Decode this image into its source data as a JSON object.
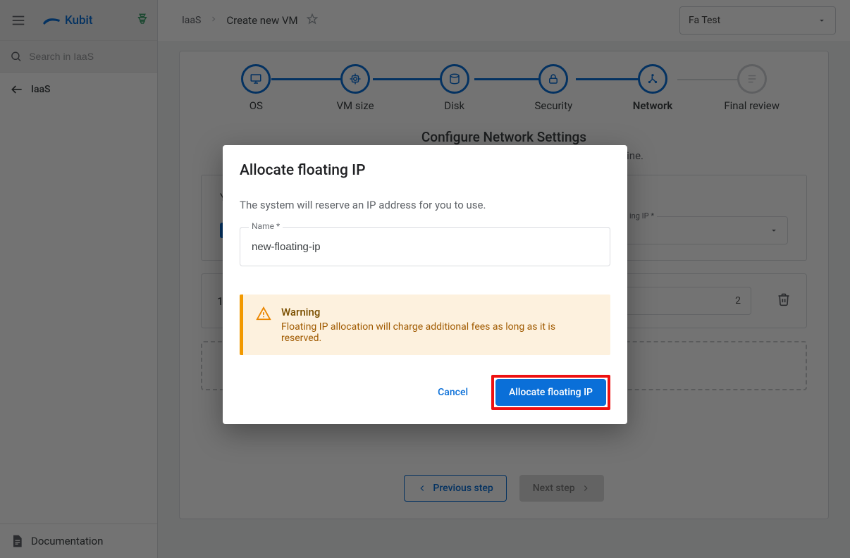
{
  "sidebar": {
    "brand": "Kubit",
    "search_placeholder": "Search in IaaS",
    "back_label": "IaaS",
    "doc_label": "Documentation"
  },
  "header": {
    "crumbs": [
      "IaaS",
      "Create new VM"
    ],
    "project_label": "Fa Test"
  },
  "stepper": {
    "steps": [
      {
        "label": "OS",
        "state": "done"
      },
      {
        "label": "VM size",
        "state": "done"
      },
      {
        "label": "Disk",
        "state": "done"
      },
      {
        "label": "Security",
        "state": "done"
      },
      {
        "label": "Network",
        "state": "active"
      },
      {
        "label": "Final review",
        "state": "inactive"
      }
    ]
  },
  "network": {
    "title": "Configure Network Settings",
    "subtitle_suffix": "ine.",
    "panel1_title_prefix": "You",
    "floating_label": "ing IP *",
    "row_index": "1",
    "row_value_suffix": "2",
    "adder_text": "",
    "prev_label": "Previous step",
    "next_label": "Next step"
  },
  "modal": {
    "title": "Allocate floating IP",
    "desc": "The system will reserve an IP address for you to use.",
    "name_label": "Name *",
    "name_value": "new-floating-ip",
    "warn_title": "Warning",
    "warn_msg": "Floating IP allocation will charge additional fees as long as it is reserved.",
    "cancel": "Cancel",
    "confirm": "Allocate floating IP"
  }
}
